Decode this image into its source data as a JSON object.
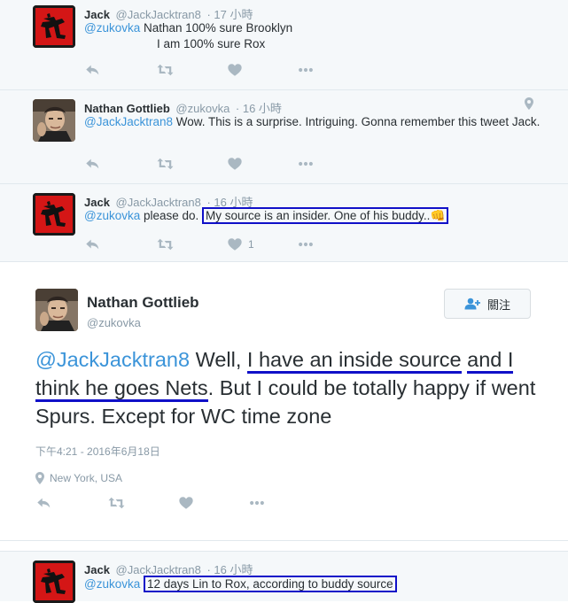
{
  "tweets": [
    {
      "name": "Jack",
      "handle": "@JackJacktran8",
      "time": "· 17 小時",
      "mention": "@zukovka",
      "text_line1": " Nathan 100% sure Brooklyn",
      "text_line2": "I am 100% sure Rox"
    },
    {
      "name": "Nathan Gottlieb",
      "handle": "@zukovka",
      "time": "· 16 小時",
      "mention": "@JackJacktran8",
      "text": "  Wow. This is a surprise. Intriguing. Gonna remember this tweet Jack."
    },
    {
      "name": "Jack",
      "handle": "@JackJacktran8",
      "time": "· 16 小時",
      "mention": "@zukovka",
      "text_pre": " please do. ",
      "text_boxed": "My source is an insider. One of his buddy..",
      "emoji": "👊",
      "like_count": "1"
    },
    {
      "name": "Jack",
      "handle": "@JackJacktran8",
      "time": "· 16 小時",
      "mention": "@zukovka",
      "text_boxed": "12 days Lin to Rox, according to buddy source"
    }
  ],
  "main_tweet": {
    "name": "Nathan Gottlieb",
    "handle": "@zukovka",
    "follow_label": "關注",
    "mention": "@JackJacktran8",
    "t1": " Well, ",
    "u1": "I have an inside source",
    "t2": " ",
    "u2": "and I think he goes Nets",
    "t3": ". But I could be totally happy if went Spurs. Except for WC time zone",
    "timestamp": "下午4:21 - 2016年6月18日",
    "location": "New York, USA"
  },
  "icons": {
    "avatar_jack": "dragon-glyph-avatar",
    "avatar_nathan": "portrait-avatar",
    "reply": "reply-icon",
    "retweet": "retweet-icon",
    "like": "heart-icon",
    "more": "more-dots-icon",
    "location": "map-pin-icon",
    "follow": "add-person-icon"
  },
  "colors": {
    "link": "#3b94d9",
    "highlight": "#1010c8",
    "muted": "#8899a6",
    "icon": "#aab8c2",
    "reply_bg": "#f5f8fa"
  }
}
